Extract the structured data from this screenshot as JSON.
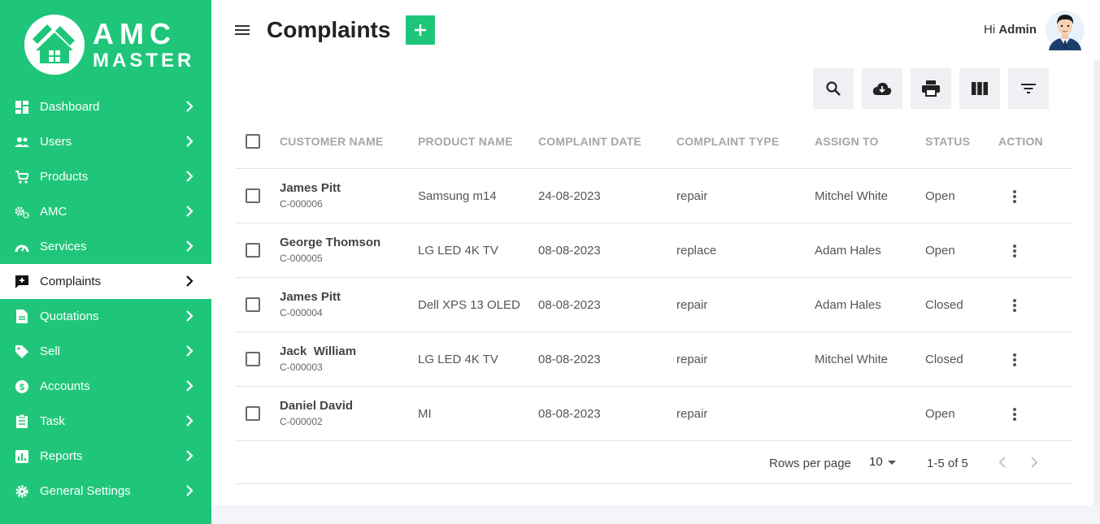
{
  "brand": {
    "line1": "AMC",
    "line2": "MASTER",
    "accent_color": "#1fc67a"
  },
  "sidebar": {
    "items": [
      {
        "label": "Dashboard",
        "icon": "dashboard-icon",
        "active": false
      },
      {
        "label": "Users",
        "icon": "users-icon",
        "active": false
      },
      {
        "label": "Products",
        "icon": "cart-icon",
        "active": false
      },
      {
        "label": "AMC",
        "icon": "gears-icon",
        "active": false
      },
      {
        "label": "Services",
        "icon": "gauge-icon",
        "active": false
      },
      {
        "label": "Complaints",
        "icon": "complaint-icon",
        "active": true
      },
      {
        "label": "Quotations",
        "icon": "document-icon",
        "active": false
      },
      {
        "label": "Sell",
        "icon": "tag-icon",
        "active": false
      },
      {
        "label": "Accounts",
        "icon": "dollar-icon",
        "active": false
      },
      {
        "label": "Task",
        "icon": "clipboard-icon",
        "active": false
      },
      {
        "label": "Reports",
        "icon": "chart-icon",
        "active": false
      },
      {
        "label": "General Settings",
        "icon": "gear-icon",
        "active": false
      }
    ]
  },
  "header": {
    "title": "Complaints",
    "greeting_prefix": "Hi",
    "user_name": "Admin"
  },
  "toolbar": {
    "buttons": [
      "search-icon",
      "download-icon",
      "print-icon",
      "columns-icon",
      "filter-icon"
    ]
  },
  "table": {
    "columns": [
      "CUSTOMER NAME",
      "PRODUCT NAME",
      "COMPLAINT DATE",
      "COMPLAINT TYPE",
      "ASSIGN TO",
      "STATUS",
      "ACTION"
    ],
    "rows": [
      {
        "customer": "James Pitt",
        "id": "C-000006",
        "product": "Samsung m14",
        "date": "24-08-2023",
        "type": "repair",
        "assign": "Mitchel White",
        "status": "Open"
      },
      {
        "customer": "George Thomson",
        "id": "C-000005",
        "product": "LG LED 4K TV",
        "date": "08-08-2023",
        "type": "replace",
        "assign": "Adam Hales",
        "status": "Open"
      },
      {
        "customer": "James Pitt",
        "id": "C-000004",
        "product": "Dell XPS 13 OLED",
        "date": "08-08-2023",
        "type": "repair",
        "assign": "Adam Hales",
        "status": "Closed"
      },
      {
        "customer": "Jack  William",
        "id": "C-000003",
        "product": "LG LED 4K TV",
        "date": "08-08-2023",
        "type": "repair",
        "assign": "Mitchel White",
        "status": "Closed"
      },
      {
        "customer": "Daniel David",
        "id": "C-000002",
        "product": "MI",
        "date": "08-08-2023",
        "type": "repair",
        "assign": "",
        "status": "Open"
      }
    ]
  },
  "pagination": {
    "rows_per_page_label": "Rows per page",
    "rows_per_page": "10",
    "range": "1-5 of 5"
  }
}
